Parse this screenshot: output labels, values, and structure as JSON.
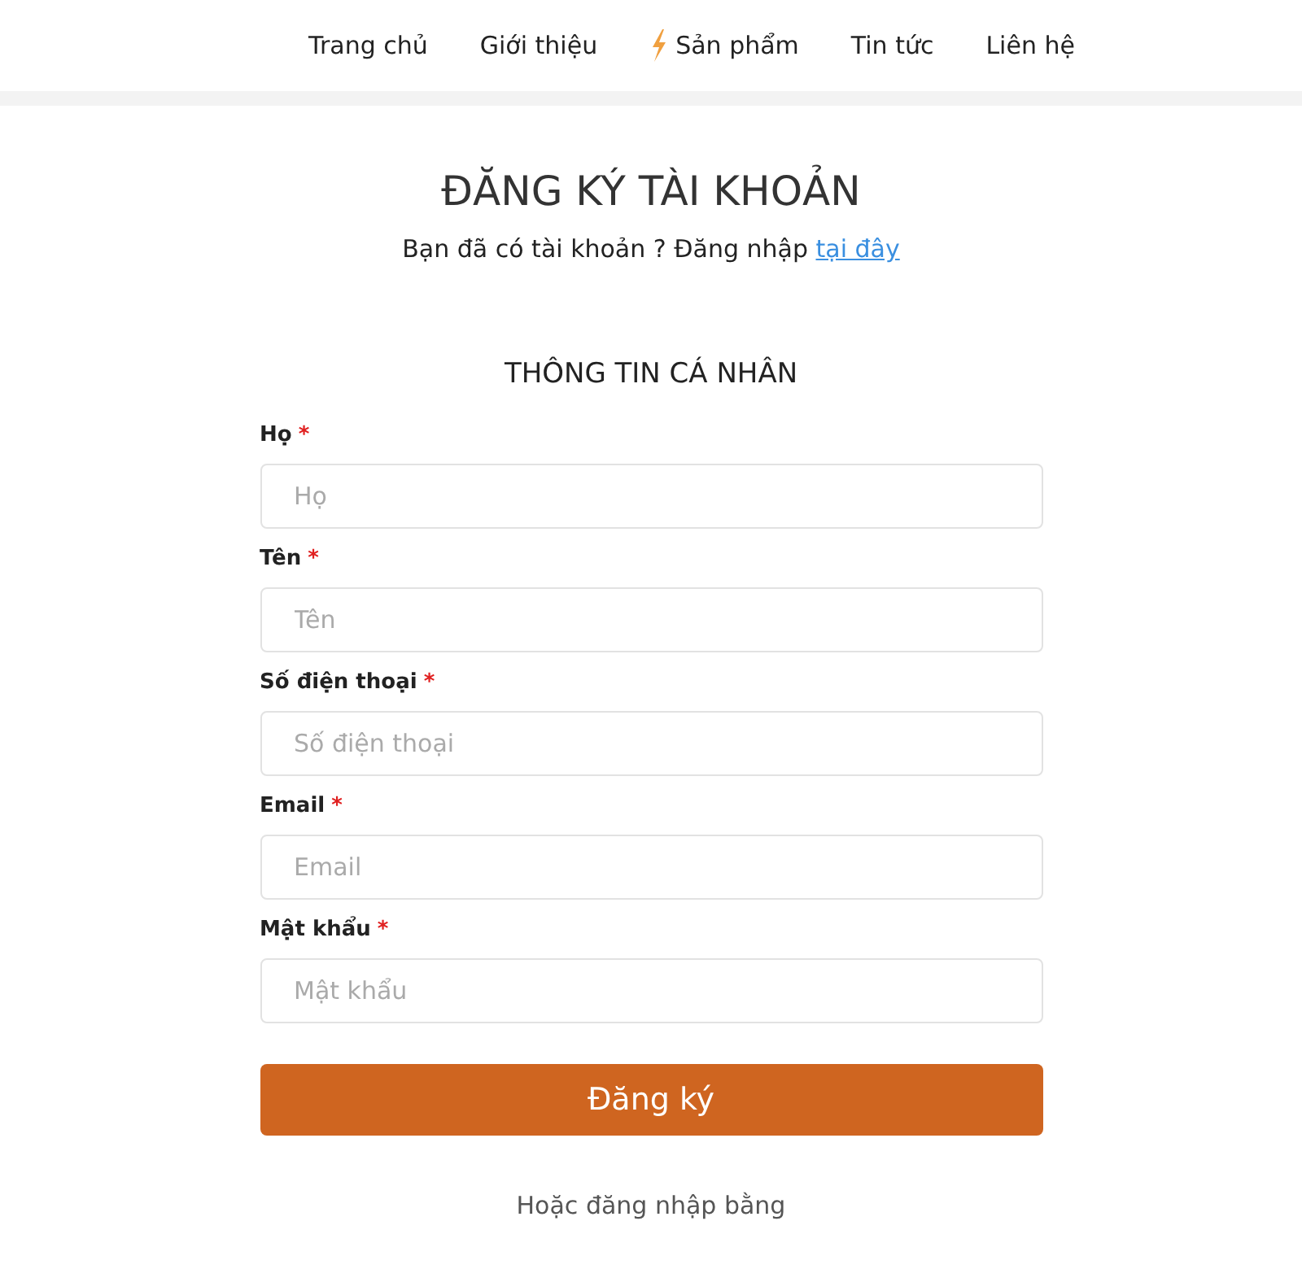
{
  "nav": [
    {
      "label": "Trang chủ",
      "kind": "plain"
    },
    {
      "label": "Giới thiệu",
      "kind": "plain"
    },
    {
      "label": "Sản phẩm",
      "kind": "featured"
    },
    {
      "label": "Tin tức",
      "kind": "plain"
    },
    {
      "label": "Liên hệ",
      "kind": "plain"
    }
  ],
  "heading": "ĐĂNG KÝ TÀI KHOẢN",
  "login_prompt": {
    "text": "Bạn đã có tài khoản ? Đăng nhập",
    "link": "tại đây"
  },
  "section_title": "THÔNG TIN CÁ NHÂN",
  "fields": [
    {
      "label": "Họ",
      "required_mark": "*",
      "placeholder": "Họ"
    },
    {
      "label": "Tên",
      "required_mark": "*",
      "placeholder": "Tên"
    },
    {
      "label": "Số điện thoại",
      "required_mark": "*",
      "placeholder": "Số điện thoại"
    },
    {
      "label": "Email",
      "required_mark": "*",
      "placeholder": "Email"
    },
    {
      "label": "Mật khẩu",
      "required_mark": "*",
      "placeholder": "Mật khẩu"
    }
  ],
  "submit_button": "Đăng ký",
  "alt_login": "Hoặc đăng nhập bằng"
}
